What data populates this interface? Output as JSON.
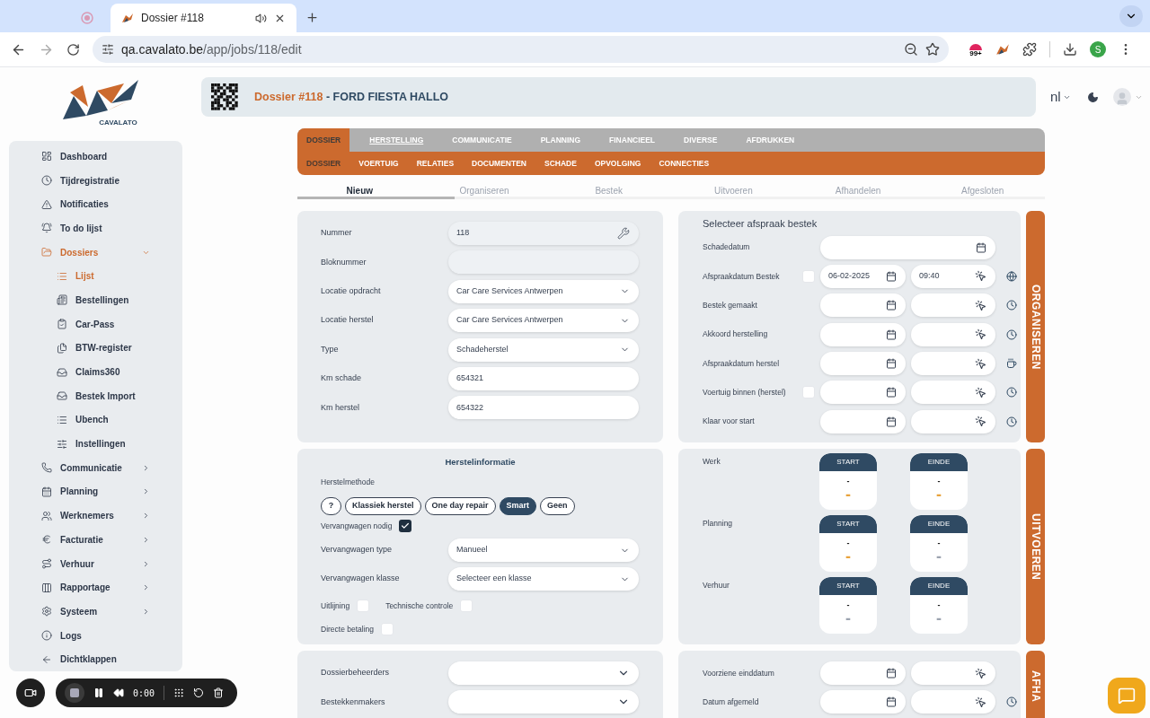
{
  "browser": {
    "tabs": [
      {
        "selected": false
      },
      {
        "title": "Dossier #118",
        "selected": true
      }
    ],
    "url_host": "qa.cavalato.be",
    "url_path": "/app/jobs/118/edit",
    "extension_badge": "99+",
    "profile_initial": "S"
  },
  "logo": {
    "text": "CAVALATO"
  },
  "sidebar": {
    "items": [
      {
        "label": "Dashboard",
        "selected": false
      },
      {
        "label": "Tijdregistratie",
        "selected": false
      },
      {
        "label": "Notificaties",
        "selected": false
      },
      {
        "label": "To do lijst",
        "selected": false
      },
      {
        "label": "Dossiers",
        "selected": true,
        "expanded": true,
        "children": [
          {
            "label": "Lijst",
            "selected": true
          },
          {
            "label": "Bestellingen",
            "selected": false
          },
          {
            "label": "Car-Pass",
            "selected": false
          },
          {
            "label": "BTW-register",
            "selected": false
          },
          {
            "label": "Claims360",
            "selected": false
          },
          {
            "label": "Bestek Import",
            "selected": false
          },
          {
            "label": "Ubench",
            "selected": false
          },
          {
            "label": "Instellingen",
            "selected": false
          }
        ]
      },
      {
        "label": "Communicatie",
        "selected": false,
        "expanded": false
      },
      {
        "label": "Planning",
        "selected": false,
        "expanded": false
      },
      {
        "label": "Werknemers",
        "selected": false,
        "expanded": false
      },
      {
        "label": "Facturatie",
        "selected": false,
        "expanded": false
      },
      {
        "label": "Verhuur",
        "selected": false,
        "expanded": false
      },
      {
        "label": "Rapportage",
        "selected": false,
        "expanded": false
      },
      {
        "label": "Systeem",
        "selected": false,
        "expanded": false
      },
      {
        "label": "Logs",
        "selected": false
      },
      {
        "label": "Dichtklappen",
        "selected": false
      }
    ]
  },
  "header": {
    "number": "Dossier #118",
    "name": "- FORD FIESTA HALLO",
    "language": "nl"
  },
  "tabs": [
    {
      "label": "DOSSIER",
      "selected": true,
      "hovered": false
    },
    {
      "label": "HERSTELLING",
      "selected": false,
      "hovered": true
    },
    {
      "label": "COMMUNICATIE",
      "selected": false,
      "hovered": false
    },
    {
      "label": "PLANNING",
      "selected": false,
      "hovered": false
    },
    {
      "label": "FINANCIEEL",
      "selected": false,
      "hovered": false
    },
    {
      "label": "DIVERSE",
      "selected": false,
      "hovered": false
    },
    {
      "label": "AFDRUKKEN",
      "selected": false,
      "hovered": false
    }
  ],
  "subtabs": [
    {
      "label": "DOSSIER",
      "selected": true
    },
    {
      "label": "VOERTUIG",
      "selected": false
    },
    {
      "label": "RELATIES",
      "selected": false
    },
    {
      "label": "DOCUMENTEN",
      "selected": false
    },
    {
      "label": "SCHADE",
      "selected": false
    },
    {
      "label": "OPVOLGING",
      "selected": false
    },
    {
      "label": "CONNECTIES",
      "selected": false
    }
  ],
  "steps": {
    "level": 0.21,
    "items": [
      {
        "label": "Nieuw",
        "selected": true
      },
      {
        "label": "Organiseren",
        "selected": false
      },
      {
        "label": "Bestek",
        "selected": false
      },
      {
        "label": "Uitvoeren",
        "selected": false
      },
      {
        "label": "Afhandelen",
        "selected": false
      },
      {
        "label": "Afgesloten",
        "selected": false
      }
    ]
  },
  "general": {
    "fields": [
      {
        "label": "Nummer",
        "value": "118",
        "kind": "text",
        "disabled": true
      },
      {
        "label": "Bloknummer",
        "kind": "text",
        "disabled": true
      },
      {
        "label": "Locatie opdracht",
        "value": "Car Care Services Antwerpen",
        "kind": "select",
        "disabled": false
      },
      {
        "label": "Locatie herstel",
        "value": "Car Care Services Antwerpen",
        "kind": "select",
        "disabled": false
      },
      {
        "label": "Type",
        "value": "Schadeherstel",
        "kind": "select",
        "disabled": false
      },
      {
        "label": "Km schade",
        "value": "654321",
        "kind": "text",
        "disabled": false
      },
      {
        "label": "Km herstel",
        "value": "654322",
        "kind": "text",
        "disabled": false
      }
    ]
  },
  "repair": {
    "title": "Herstelinformatie",
    "method_label": "Herstelmethode",
    "methods": [
      {
        "label": "?",
        "selected": false
      },
      {
        "label": "Klassiek herstel",
        "selected": false
      },
      {
        "label": "One day repair",
        "selected": false
      },
      {
        "label": "Smart",
        "selected": true
      },
      {
        "label": "Geen",
        "selected": false
      }
    ],
    "replacement_needed": {
      "label": "Vervangwagen nodig",
      "checked": true
    },
    "fields": [
      {
        "label": "Vervangwagen type",
        "value": "Manueel"
      },
      {
        "label": "Vervangwagen klasse",
        "value": "Selecteer een klasse"
      }
    ],
    "checks": [
      {
        "label": "Uitlijning",
        "checked": false
      },
      {
        "label": "Technische controle",
        "checked": false
      },
      {
        "label": "Directe betaling",
        "checked": false
      }
    ]
  },
  "people": {
    "fields": [
      {
        "label": "Dossierbeheerders"
      },
      {
        "label": "Bestekkenmakers"
      }
    ]
  },
  "appointments": {
    "title": "Selecteer afspraak bestek",
    "rows": [
      {
        "label": "Schadedatum",
        "kind": "wide"
      },
      {
        "label": "Afspraakdatum Bestek",
        "kind": "datetime",
        "checkbox": {
          "checked": false
        },
        "date": "06-02-2025",
        "time": "09:40"
      },
      {
        "label": "Bestek gemaakt",
        "kind": "datetime"
      },
      {
        "label": "Akkoord herstelling",
        "kind": "datetime"
      },
      {
        "label": "Afspraakdatum herstel",
        "kind": "datetime"
      },
      {
        "label": "Voertuig binnen (herstel)",
        "kind": "datetime",
        "checkbox": {
          "checked": false
        }
      },
      {
        "label": "Klaar voor start",
        "kind": "datetime"
      }
    ]
  },
  "execution": {
    "rows": [
      {
        "label": "Werk",
        "cards": [
          {
            "label": "START",
            "top": "-",
            "bottom": "-",
            "color": "#e8a33c"
          },
          {
            "label": "EINDE",
            "top": "-",
            "bottom": "-",
            "color": "#e8a33c"
          }
        ]
      },
      {
        "label": "Planning",
        "cards": [
          {
            "label": "START",
            "top": "-",
            "bottom": "-",
            "color": "#e8a33c"
          },
          {
            "label": "EINDE",
            "top": "-",
            "bottom": "-",
            "color": "#9ca3af"
          }
        ]
      },
      {
        "label": "Verhuur",
        "cards": [
          {
            "label": "START",
            "top": "-",
            "bottom": "-",
            "color": "#9ca3af"
          },
          {
            "label": "EINDE",
            "top": "-",
            "bottom": "-",
            "color": "#9ca3af"
          }
        ]
      }
    ]
  },
  "closing": {
    "rows": [
      {
        "label": "Voorziene einddatum"
      },
      {
        "label": "Datum afgemeld"
      }
    ]
  },
  "phases": [
    "ORGANISEREN",
    "UITVOEREN",
    "AFHA"
  ],
  "recorder": {
    "time": "0:00"
  }
}
